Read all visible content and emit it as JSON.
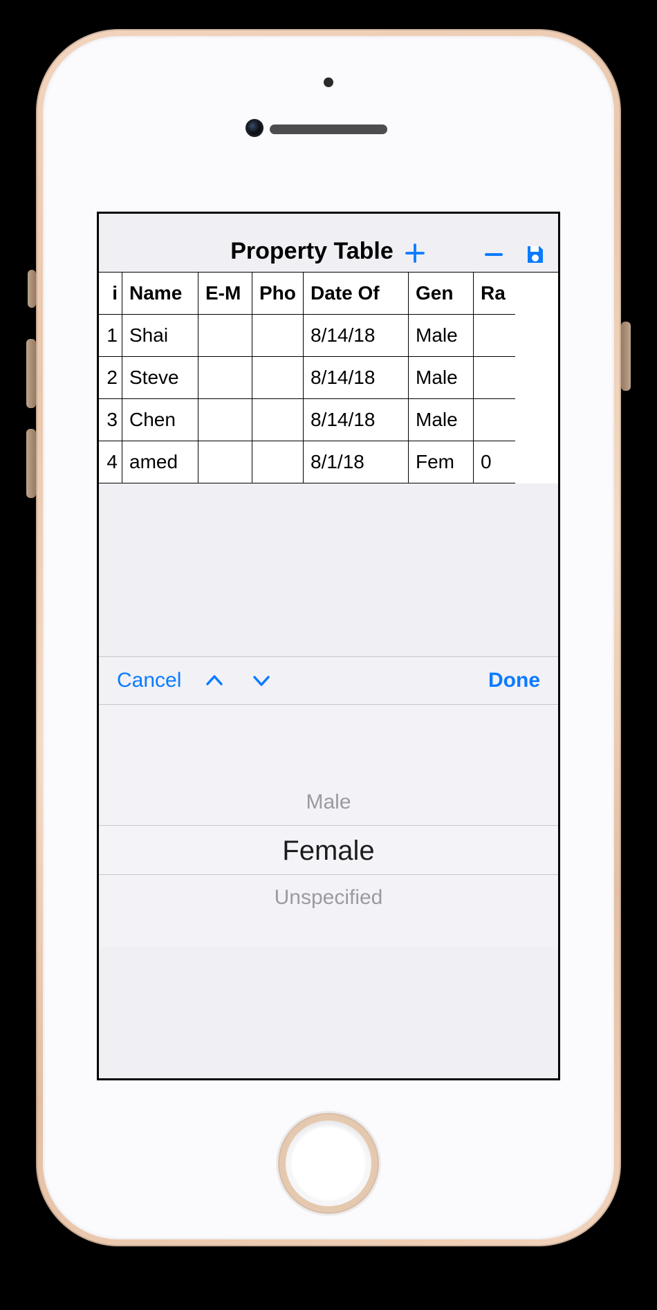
{
  "titlebar": {
    "title": "Property Table",
    "add_icon": "plus-icon",
    "remove_icon": "minus-icon",
    "save_icon": "save-icon"
  },
  "table": {
    "headers": [
      "i",
      "Name",
      "E-M",
      "Pho",
      "Date Of",
      "Gen",
      "Ra"
    ],
    "rows": [
      {
        "id": "1",
        "name": "Shai",
        "email": "",
        "phone": "",
        "dob": "8/14/18",
        "gender": "Male",
        "rank": ""
      },
      {
        "id": "2",
        "name": "Steve",
        "email": "",
        "phone": "",
        "dob": "8/14/18",
        "gender": "Male",
        "rank": ""
      },
      {
        "id": "3",
        "name": "Chen",
        "email": "",
        "phone": "",
        "dob": "8/14/18",
        "gender": "Male",
        "rank": ""
      },
      {
        "id": "4",
        "name": "amed",
        "email": "",
        "phone": "",
        "dob": "8/1/18",
        "gender": "Fem",
        "rank": "0"
      }
    ]
  },
  "accessory": {
    "cancel_label": "Cancel",
    "done_label": "Done"
  },
  "picker": {
    "options": [
      "Male",
      "Female",
      "Unspecified"
    ],
    "selected": "Female"
  }
}
